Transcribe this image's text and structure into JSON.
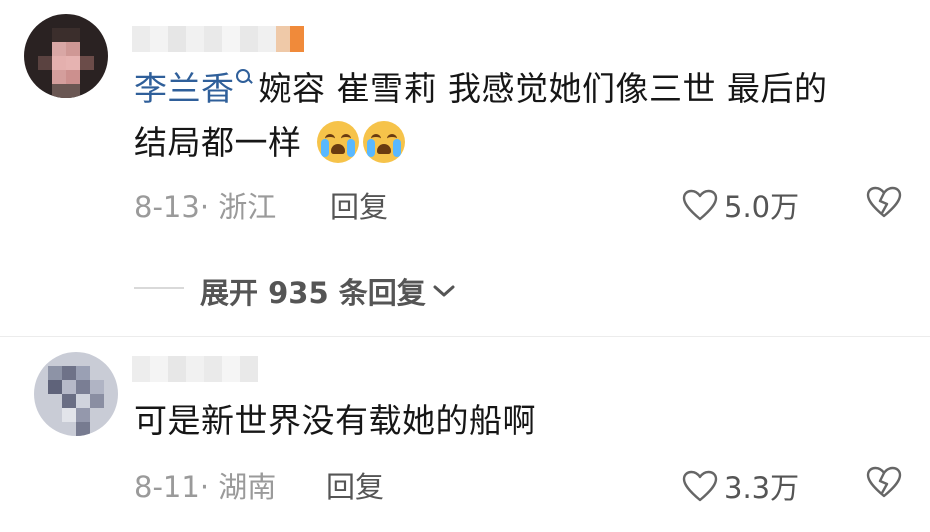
{
  "comments": [
    {
      "mention": "李兰香",
      "text": "婉容 崔雪莉 我感觉她们像三世 最后的",
      "text2": "结局都一样",
      "date_location": "8-13· 浙江",
      "reply_label": "回复",
      "likes": "5.0万",
      "expand_label": "展开 935 条回复"
    },
    {
      "text": "可是新世界没有载她的船啊",
      "date_location": "8-11· 湖南",
      "reply_label": "回复",
      "likes": "3.3万"
    }
  ],
  "icons": {
    "heart": "heart-outline-icon",
    "dislike": "broken-heart-icon",
    "search": "search-icon",
    "chevron": "chevron-down-icon",
    "emoji": "loudly-crying-face-emoji"
  },
  "colors": {
    "mention": "#2f5f9a",
    "meta": "#9a9a9a",
    "text": "#161616"
  }
}
